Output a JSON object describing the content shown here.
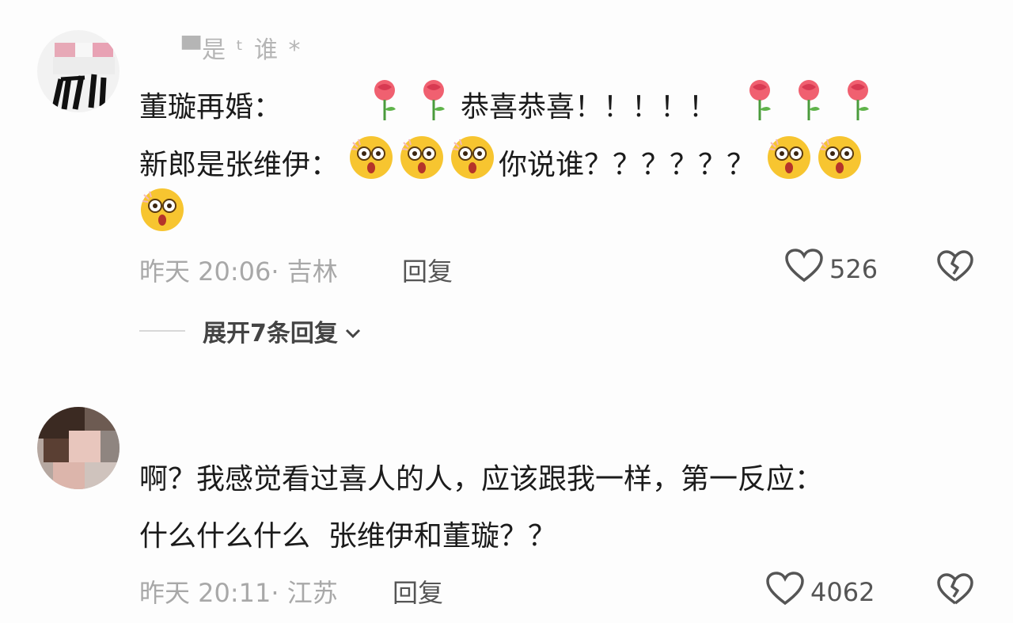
{
  "comments": [
    {
      "username": "▀是 ᵗ 谁 *",
      "lines": [
        [
          "董璇再婚：",
          "🌹",
          "🌹",
          "恭喜恭喜！！！！！",
          "🌹",
          "🌹",
          "🌹"
        ],
        [
          "新郎是张维伊：",
          "😲",
          "😲",
          "😲",
          "你说谁？？？？？？",
          "😲",
          "😲"
        ],
        [
          "😲"
        ]
      ],
      "time": "昨天 20:06",
      "location": "· 吉林",
      "reply_label": "回复",
      "likes": "526",
      "expand_label": "展开7条回复"
    },
    {
      "lines": [
        [
          "啊？我感觉看过喜人的人，应该跟我一样，第一反应："
        ],
        [
          "什么什么什么  张维伊和董璇？？"
        ]
      ],
      "time": "昨天 20:11",
      "location": "· 江苏",
      "reply_label": "回复",
      "likes": "4062"
    }
  ],
  "colors": {
    "background": "#fdfdfd",
    "meta_text": "#a8a8a8",
    "body_text": "#1b1b1b",
    "action_text": "#555555"
  },
  "icons": [
    "rose-emoji",
    "shocked-emoji",
    "heart-icon",
    "broken-heart-icon",
    "chevron-down-icon"
  ]
}
